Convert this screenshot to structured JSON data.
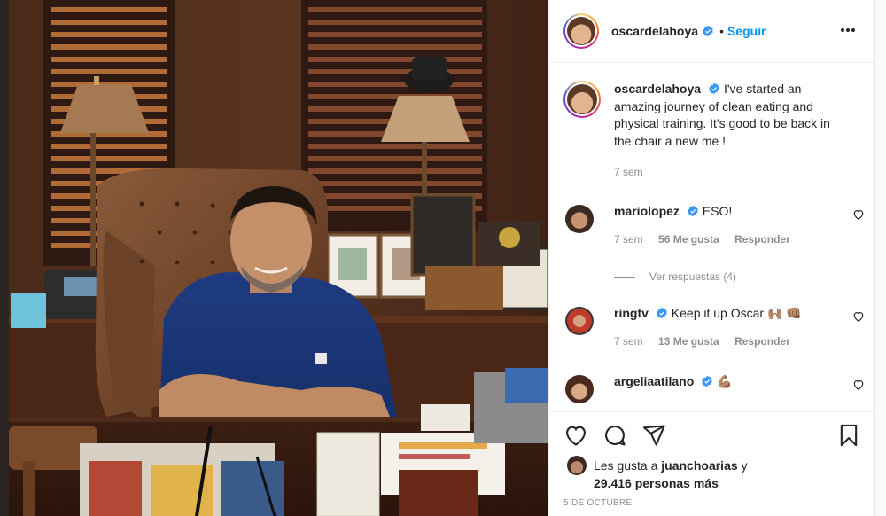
{
  "post": {
    "author": "oscardelahoya",
    "follow_label": "Seguir",
    "dot": "•",
    "caption": "I've started an amazing journey of clean eating and physical training. It's good to be back in the chair a new me !",
    "caption_time": "7 sem",
    "date": "5 DE OCTUBRE",
    "likes_prefix": "Les gusta a ",
    "likes_user": "juanchoarias",
    "likes_suffix": " y",
    "likes_count_text": "29.416 personas más"
  },
  "comments": [
    {
      "user": "mariolopez",
      "text": "ESO!",
      "time": "7 sem",
      "likes": "56 Me gusta",
      "reply": "Responder",
      "replies_label": "Ver respuestas (4)"
    },
    {
      "user": "ringtv",
      "text": "Keep it up Oscar 🙌🏽 👊🏽",
      "time": "7 sem",
      "likes": "13 Me gusta",
      "reply": "Responder"
    },
    {
      "user": "argeliaatilano",
      "text": "💪🏽"
    }
  ],
  "icons": {
    "verified": "verified-badge-icon",
    "more": "more-options-icon",
    "heart": "heart-icon",
    "comment": "comment-icon",
    "share": "share-icon",
    "save": "bookmark-icon"
  },
  "colors": {
    "accent": "#0095f6",
    "verified": "#3897f0",
    "muted": "#8e8e8e"
  }
}
